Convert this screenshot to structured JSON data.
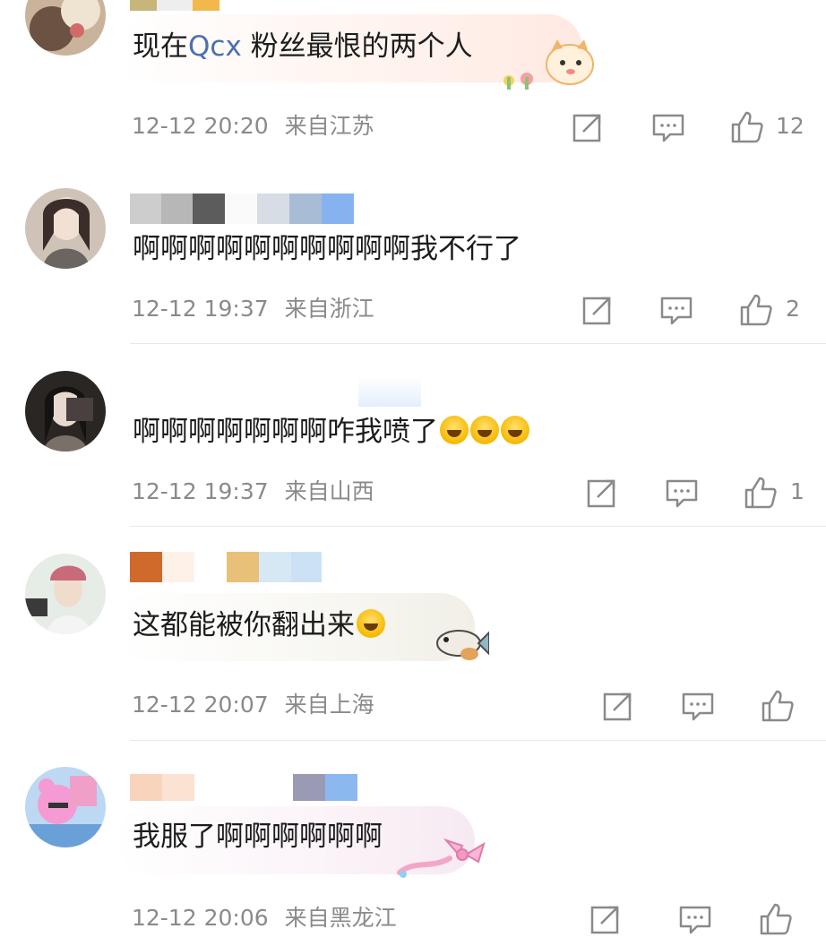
{
  "comments": [
    {
      "text_before": "现在",
      "search_glyph": "Q",
      "search_term": "cx",
      "text_after": " 粉丝最恨的两个人",
      "time": "12-12 20:20",
      "location": "来自江苏",
      "likes": "12",
      "sticker": "cat-sticker"
    },
    {
      "text": "啊啊啊啊啊啊啊啊啊啊我不行了",
      "time": "12-12 19:37",
      "location": "来自浙江",
      "likes": "2"
    },
    {
      "text": "啊啊啊啊啊啊啊咋我喷了",
      "emoji": "laugh-cry-emoji",
      "time": "12-12 19:37",
      "location": "来自山西",
      "likes": "1"
    },
    {
      "text": "这都能被你翻出来",
      "emoji": "shocked-emoji",
      "time": "12-12 20:07",
      "location": "来自上海",
      "likes": "",
      "sticker": "fish-sticker"
    },
    {
      "text": "我服了啊啊啊啊啊啊",
      "time": "12-12 20:06",
      "location": "来自黑龙江",
      "likes": "",
      "sticker": "bow-sticker"
    }
  ],
  "colors": {
    "meta_text": "#8a8a8a",
    "search_accent": "#4b6fb3",
    "divider": "#e8e8e8"
  }
}
